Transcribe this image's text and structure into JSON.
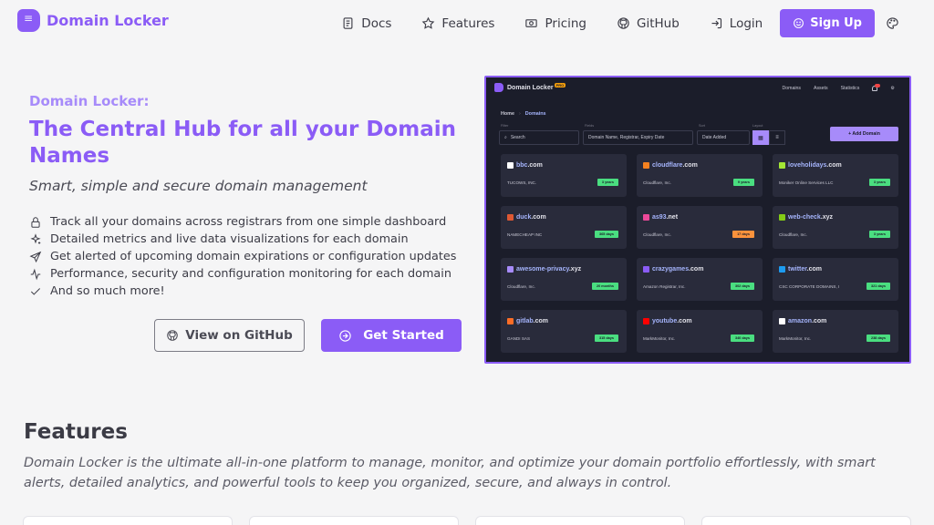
{
  "nav": {
    "brand": "Domain Locker",
    "links": [
      {
        "label": "Docs",
        "icon": "docs-icon"
      },
      {
        "label": "Features",
        "icon": "star-icon"
      },
      {
        "label": "Pricing",
        "icon": "pricing-icon"
      },
      {
        "label": "GitHub",
        "icon": "github-icon"
      },
      {
        "label": "Login",
        "icon": "login-icon"
      }
    ],
    "signup": "Sign Up"
  },
  "hero": {
    "eyebrow": "Domain Locker:",
    "title": "The Central Hub for all your Domain Names",
    "subtitle": "Smart, simple and secure domain management",
    "features": [
      "Track all your domains across registrars from one simple dashboard",
      "Detailed metrics and live data visualizations for each domain",
      "Get alerted of upcoming domain expirations or configuration updates",
      "Performance, security and configuration monitoring for each domain",
      "And so much more!"
    ],
    "github_button": "View on GitHub",
    "start_button": "Get Started"
  },
  "preview": {
    "brand": "Domain Locker",
    "badge": "PRO",
    "menu": [
      "Domains",
      "Assets",
      "Statistics"
    ],
    "breadcrumb": [
      "Home",
      "Domains"
    ],
    "filter_label": "Filter",
    "fields_label": "Fields",
    "sort_label": "Sort",
    "layout_label": "Layout",
    "search_placeholder": "Search",
    "fields_value": "Domain Name, Registrar, Expiry Date",
    "sort_value": "Date Added",
    "add_button": "+ Add Domain",
    "colors": {
      "green": "#4ade80",
      "orange": "#fb923c",
      "accent": "#a78bfa"
    },
    "domains": [
      {
        "name": "bbc",
        "tld": ".com",
        "registrar": "TUCOWS, INC.",
        "expiry": "3 years",
        "status": "green",
        "icon_color": "#ffffff"
      },
      {
        "name": "cloudflare",
        "tld": ".com",
        "registrar": "Cloudflare, Inc.",
        "expiry": "9 years",
        "status": "green",
        "icon_color": "#f48120"
      },
      {
        "name": "loveholidays",
        "tld": ".com",
        "registrar": "Moniker Online Services LLC",
        "expiry": "3 years",
        "status": "green",
        "icon_color": "#a3e635"
      },
      {
        "name": "duck",
        "tld": ".com",
        "registrar": "NAMECHEAP INC",
        "expiry": "365 days",
        "status": "green",
        "icon_color": "#de5833"
      },
      {
        "name": "as93",
        "tld": ".net",
        "registrar": "Cloudflare, Inc.",
        "expiry": "17 days",
        "status": "orange",
        "icon_color": "#ec4899"
      },
      {
        "name": "web-check",
        "tld": ".xyz",
        "registrar": "Cloudflare, Inc.",
        "expiry": "3 years",
        "status": "green",
        "icon_color": "#84cc16"
      },
      {
        "name": "awesome-privacy",
        "tld": ".xyz",
        "registrar": "Cloudflare, Inc.",
        "expiry": "20 months",
        "status": "green",
        "icon_color": "#a78bfa"
      },
      {
        "name": "crazygames",
        "tld": ".com",
        "registrar": "Amazon Registrar, Inc.",
        "expiry": "302 days",
        "status": "green",
        "icon_color": "#8b5cf6"
      },
      {
        "name": "twitter",
        "tld": ".com",
        "registrar": "CSC CORPORATE DOMAINS, I",
        "expiry": "321 days",
        "status": "green",
        "icon_color": "#1d9bf0"
      },
      {
        "name": "gitlab",
        "tld": ".com",
        "registrar": "GANDI SAS",
        "expiry": "315 days",
        "status": "green",
        "icon_color": "#fc6d26"
      },
      {
        "name": "youtube",
        "tld": ".com",
        "registrar": "MarkMonitor, Inc.",
        "expiry": "340 days",
        "status": "green",
        "icon_color": "#ff0000"
      },
      {
        "name": "amazon",
        "tld": ".com",
        "registrar": "MarkMonitor, Inc.",
        "expiry": "238 days",
        "status": "green",
        "icon_color": "#ffffff"
      }
    ]
  },
  "features_section": {
    "title": "Features",
    "description": "Domain Locker is the ultimate all-in-one platform to manage, monitor, and optimize your domain portfolio effortlessly, with smart alerts, detailed analytics, and powerful tools to keep you organized, secure, and always in control."
  }
}
